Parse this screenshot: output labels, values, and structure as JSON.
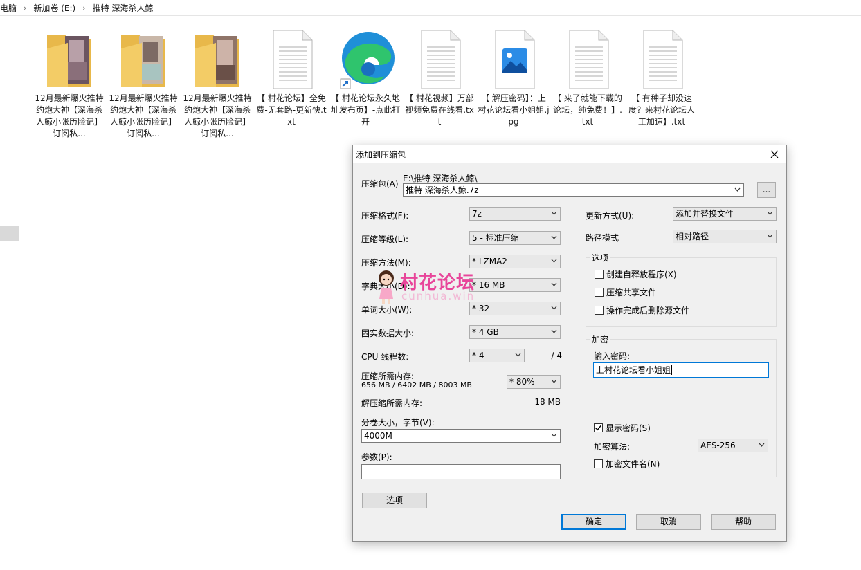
{
  "explorer": {
    "breadcrumb": [
      "电脑",
      "新加卷 (E:)",
      "推特 深海杀人鲸"
    ],
    "files": [
      {
        "type": "folder",
        "name": "12月最新爆火推特约炮大神【深海杀人鲸小张历险记】订阅私..."
      },
      {
        "type": "folder",
        "name": "12月最新爆火推特约炮大神【深海杀人鲸小张历险记】订阅私..."
      },
      {
        "type": "folder",
        "name": "12月最新爆火推特约炮大神【深海杀人鲸小张历险记】订阅私..."
      },
      {
        "type": "txt",
        "name": "【 村花论坛】全免费-无套路-更新快.txt"
      },
      {
        "type": "edge",
        "name": "【 村花论坛永久地址发布页】-点此打开"
      },
      {
        "type": "txt",
        "name": "【 村花视频】万部视频免费在线看.txt"
      },
      {
        "type": "jpg",
        "name": "【 解压密码】：上村花论坛看小姐姐.jpg"
      },
      {
        "type": "txt",
        "name": "【 来了就能下载的论坛，纯免费！】.txt"
      },
      {
        "type": "txt",
        "name": "【 有种子却没速度？来村花论坛人工加速】.txt"
      }
    ]
  },
  "dialog": {
    "title": "添加到压缩包",
    "archive_label": "压缩包(A)",
    "archive_path": "E:\\推特 深海杀人鲸\\",
    "archive_name": "推特 深海杀人鲸.7z",
    "browse_label": "...",
    "format_label": "压缩格式(F):",
    "format_value": "7z",
    "level_label": "压缩等级(L):",
    "level_value": "5 - 标准压缩",
    "method_label": "压缩方法(M):",
    "method_value": "* LZMA2",
    "dict_label": "字典大小(D):",
    "dict_value": "* 16 MB",
    "word_label": "单词大小(W):",
    "word_value": "* 32",
    "solid_label": "固实数据大小:",
    "solid_value": "* 4 GB",
    "cpu_label": "CPU 线程数:",
    "cpu_value": "* 4",
    "cpu_total": "/ 4",
    "mem_label": "压缩所需内存:",
    "mem_value": "656 MB / 6402 MB / 8003 MB",
    "mem_percent": "* 80%",
    "decomp_label": "解压缩所需内存:",
    "decomp_value": "18 MB",
    "split_label": "分卷大小，字节(V):",
    "split_value": "4000M",
    "params_label": "参数(P):",
    "params_value": "",
    "options_button": "选项",
    "update_label": "更新方式(U):",
    "update_value": "添加并替换文件",
    "path_label": "路径模式",
    "path_value": "相对路径",
    "options_group": "选项",
    "opt_sfx": "创建自释放程序(X)",
    "opt_shared": "压缩共享文件",
    "opt_delete": "操作完成后删除源文件",
    "enc_group": "加密",
    "enc_password_label": "输入密码:",
    "enc_password_value": "上村花论坛看小姐姐",
    "show_password": "显示密码(S)",
    "enc_method_label": "加密算法:",
    "enc_method_value": "AES-256",
    "enc_names": "加密文件名(N)",
    "ok": "确定",
    "cancel": "取消",
    "help": "帮助"
  },
  "watermark": {
    "main": "村花论坛",
    "sub": "cunhua.win"
  },
  "colors": {
    "accent": "#0078d7",
    "watermark": "#e8459a",
    "dialog_bg": "#f0f0f0"
  }
}
